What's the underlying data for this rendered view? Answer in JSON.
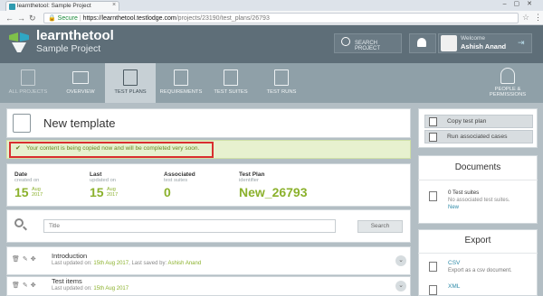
{
  "browser": {
    "tab_title": "learnthetool: Sample Project",
    "secure_label": "Secure",
    "url_host": "https://learnthetool.testlodge.com",
    "url_path": "/projects/23190/test_plans/26793"
  },
  "header": {
    "brand": "learnthetool",
    "project": "Sample Project",
    "search_label": "SEARCH PROJECT",
    "welcome": "Welcome",
    "user_name": "Ashish Anand"
  },
  "nav": {
    "all_projects": "ALL PROJECTS",
    "overview": "OVERVIEW",
    "test_plans": "TEST PLANS",
    "requirements": "REQUIREMENTS",
    "test_suites": "TEST SUITES",
    "test_runs": "TEST RUNS",
    "people_1": "PEOPLE &",
    "people_2": "PERMISSIONS"
  },
  "main": {
    "title": "New template",
    "alert": "Your content is being copied now and will be completed very soon.",
    "stats": [
      {
        "label": "Date",
        "sub": "created on",
        "big": "15",
        "small1": "Aug",
        "small2": "2017"
      },
      {
        "label": "Last",
        "sub": "updated on",
        "big": "15",
        "small1": "Aug",
        "small2": "2017"
      },
      {
        "label": "Associated",
        "sub": "test suites",
        "big": "0"
      },
      {
        "label": "Test Plan",
        "sub": "identifier",
        "big": "New_26793"
      }
    ],
    "search_placeholder": "Title",
    "search_button": "Search",
    "rows": [
      {
        "title": "Introduction",
        "meta_prefix": "Last updated on:",
        "date": "15th Aug 2017",
        "saved_by_label": ", Last saved by:",
        "saved_by": "Ashish Anand"
      },
      {
        "title": "Test items",
        "meta_prefix": "Last updated on:",
        "date": "15th Aug 2017"
      }
    ]
  },
  "sidebar": {
    "copy_plan": "Copy test plan",
    "run_cases": "Run associated cases",
    "documents_title": "Documents",
    "documents_count": "0 Test suites",
    "documents_none": "No associated test suites.",
    "documents_new": "New",
    "export_title": "Export",
    "csv_label": "CSV",
    "csv_desc": "Export as a csv document.",
    "xml_label": "XML"
  }
}
